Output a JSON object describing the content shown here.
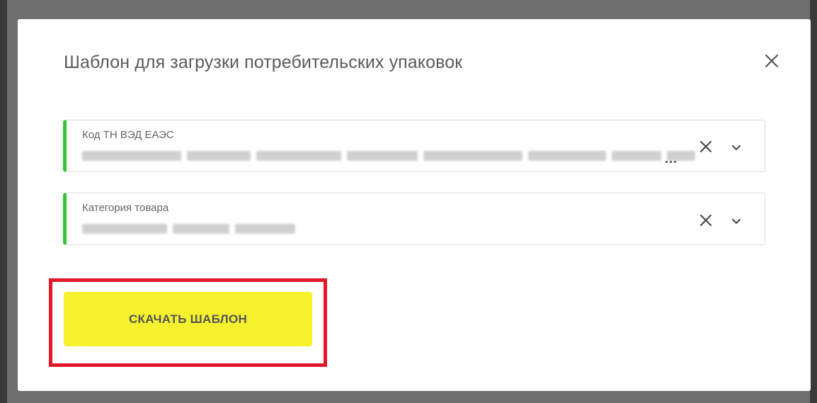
{
  "modal": {
    "title": "Шаблон для загрузки потребительских упаковок"
  },
  "fields": [
    {
      "label": "Код ТН ВЭД ЕАЭС",
      "value_obscured": true,
      "truncated_marker": "..."
    },
    {
      "label": "Категория товара",
      "value_obscured": true
    }
  ],
  "actions": {
    "download_label": "СКАЧАТЬ ШАБЛОН"
  },
  "colors": {
    "accent_bar": "#36c23a",
    "button_bg": "#f5f22d",
    "highlight_border": "#e3172a"
  },
  "icons": {
    "close": "close-icon",
    "clear": "clear-icon",
    "dropdown": "chevron-down-icon"
  }
}
